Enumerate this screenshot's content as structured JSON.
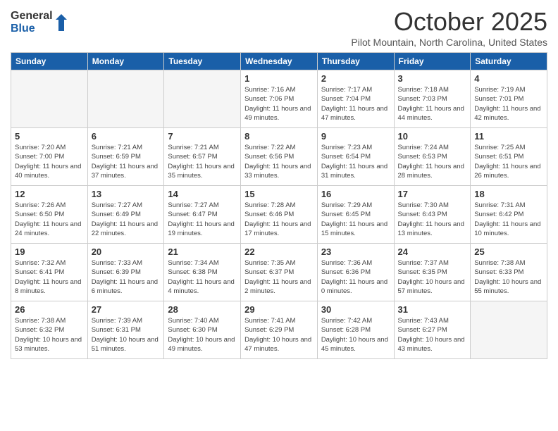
{
  "logo": {
    "general": "General",
    "blue": "Blue"
  },
  "title": "October 2025",
  "location": "Pilot Mountain, North Carolina, United States",
  "days_of_week": [
    "Sunday",
    "Monday",
    "Tuesday",
    "Wednesday",
    "Thursday",
    "Friday",
    "Saturday"
  ],
  "weeks": [
    [
      {
        "day": "",
        "info": ""
      },
      {
        "day": "",
        "info": ""
      },
      {
        "day": "",
        "info": ""
      },
      {
        "day": "1",
        "info": "Sunrise: 7:16 AM\nSunset: 7:06 PM\nDaylight: 11 hours and 49 minutes."
      },
      {
        "day": "2",
        "info": "Sunrise: 7:17 AM\nSunset: 7:04 PM\nDaylight: 11 hours and 47 minutes."
      },
      {
        "day": "3",
        "info": "Sunrise: 7:18 AM\nSunset: 7:03 PM\nDaylight: 11 hours and 44 minutes."
      },
      {
        "day": "4",
        "info": "Sunrise: 7:19 AM\nSunset: 7:01 PM\nDaylight: 11 hours and 42 minutes."
      }
    ],
    [
      {
        "day": "5",
        "info": "Sunrise: 7:20 AM\nSunset: 7:00 PM\nDaylight: 11 hours and 40 minutes."
      },
      {
        "day": "6",
        "info": "Sunrise: 7:21 AM\nSunset: 6:59 PM\nDaylight: 11 hours and 37 minutes."
      },
      {
        "day": "7",
        "info": "Sunrise: 7:21 AM\nSunset: 6:57 PM\nDaylight: 11 hours and 35 minutes."
      },
      {
        "day": "8",
        "info": "Sunrise: 7:22 AM\nSunset: 6:56 PM\nDaylight: 11 hours and 33 minutes."
      },
      {
        "day": "9",
        "info": "Sunrise: 7:23 AM\nSunset: 6:54 PM\nDaylight: 11 hours and 31 minutes."
      },
      {
        "day": "10",
        "info": "Sunrise: 7:24 AM\nSunset: 6:53 PM\nDaylight: 11 hours and 28 minutes."
      },
      {
        "day": "11",
        "info": "Sunrise: 7:25 AM\nSunset: 6:51 PM\nDaylight: 11 hours and 26 minutes."
      }
    ],
    [
      {
        "day": "12",
        "info": "Sunrise: 7:26 AM\nSunset: 6:50 PM\nDaylight: 11 hours and 24 minutes."
      },
      {
        "day": "13",
        "info": "Sunrise: 7:27 AM\nSunset: 6:49 PM\nDaylight: 11 hours and 22 minutes."
      },
      {
        "day": "14",
        "info": "Sunrise: 7:27 AM\nSunset: 6:47 PM\nDaylight: 11 hours and 19 minutes."
      },
      {
        "day": "15",
        "info": "Sunrise: 7:28 AM\nSunset: 6:46 PM\nDaylight: 11 hours and 17 minutes."
      },
      {
        "day": "16",
        "info": "Sunrise: 7:29 AM\nSunset: 6:45 PM\nDaylight: 11 hours and 15 minutes."
      },
      {
        "day": "17",
        "info": "Sunrise: 7:30 AM\nSunset: 6:43 PM\nDaylight: 11 hours and 13 minutes."
      },
      {
        "day": "18",
        "info": "Sunrise: 7:31 AM\nSunset: 6:42 PM\nDaylight: 11 hours and 10 minutes."
      }
    ],
    [
      {
        "day": "19",
        "info": "Sunrise: 7:32 AM\nSunset: 6:41 PM\nDaylight: 11 hours and 8 minutes."
      },
      {
        "day": "20",
        "info": "Sunrise: 7:33 AM\nSunset: 6:39 PM\nDaylight: 11 hours and 6 minutes."
      },
      {
        "day": "21",
        "info": "Sunrise: 7:34 AM\nSunset: 6:38 PM\nDaylight: 11 hours and 4 minutes."
      },
      {
        "day": "22",
        "info": "Sunrise: 7:35 AM\nSunset: 6:37 PM\nDaylight: 11 hours and 2 minutes."
      },
      {
        "day": "23",
        "info": "Sunrise: 7:36 AM\nSunset: 6:36 PM\nDaylight: 11 hours and 0 minutes."
      },
      {
        "day": "24",
        "info": "Sunrise: 7:37 AM\nSunset: 6:35 PM\nDaylight: 10 hours and 57 minutes."
      },
      {
        "day": "25",
        "info": "Sunrise: 7:38 AM\nSunset: 6:33 PM\nDaylight: 10 hours and 55 minutes."
      }
    ],
    [
      {
        "day": "26",
        "info": "Sunrise: 7:38 AM\nSunset: 6:32 PM\nDaylight: 10 hours and 53 minutes."
      },
      {
        "day": "27",
        "info": "Sunrise: 7:39 AM\nSunset: 6:31 PM\nDaylight: 10 hours and 51 minutes."
      },
      {
        "day": "28",
        "info": "Sunrise: 7:40 AM\nSunset: 6:30 PM\nDaylight: 10 hours and 49 minutes."
      },
      {
        "day": "29",
        "info": "Sunrise: 7:41 AM\nSunset: 6:29 PM\nDaylight: 10 hours and 47 minutes."
      },
      {
        "day": "30",
        "info": "Sunrise: 7:42 AM\nSunset: 6:28 PM\nDaylight: 10 hours and 45 minutes."
      },
      {
        "day": "31",
        "info": "Sunrise: 7:43 AM\nSunset: 6:27 PM\nDaylight: 10 hours and 43 minutes."
      },
      {
        "day": "",
        "info": ""
      }
    ]
  ]
}
